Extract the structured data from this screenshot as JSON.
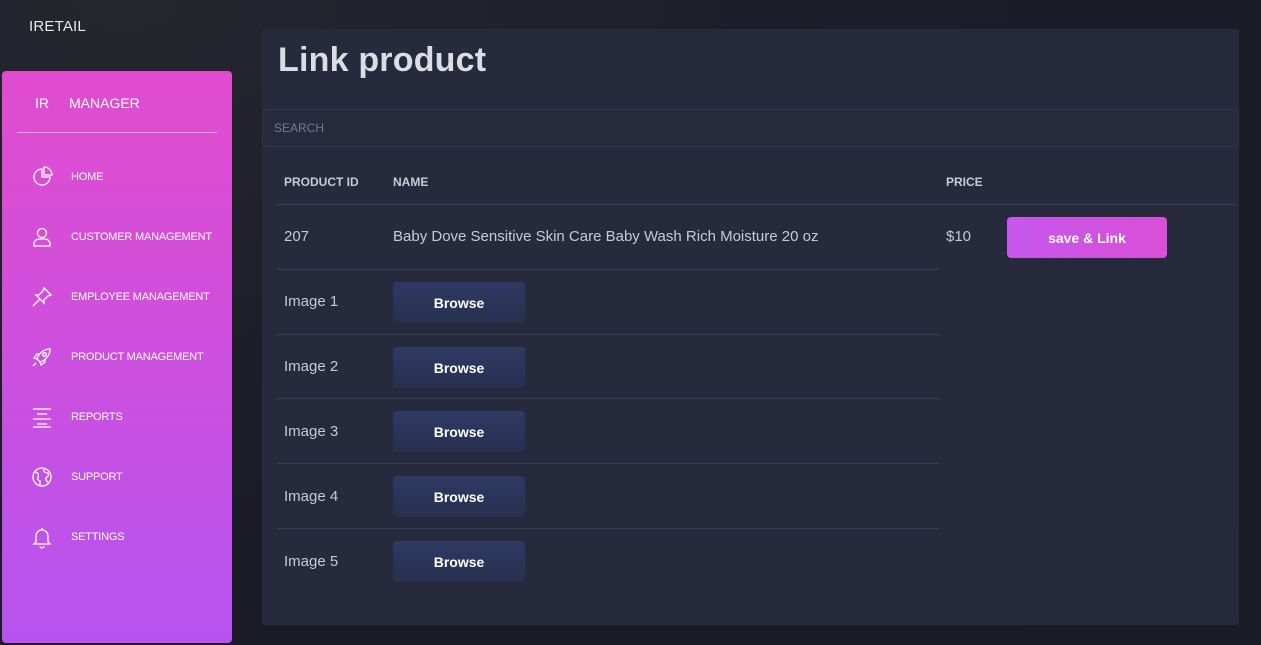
{
  "brand": "IRETAIL",
  "sidebar": {
    "logo_mini": "IR",
    "logo_full": "MANAGER",
    "items": [
      {
        "label": "HOME",
        "icon": "pie-chart-icon"
      },
      {
        "label": "CUSTOMER MANAGEMENT",
        "icon": "user-icon"
      },
      {
        "label": "EMPLOYEE MANAGEMENT",
        "icon": "pin-icon"
      },
      {
        "label": "PRODUCT MANAGEMENT",
        "icon": "rocket-icon"
      },
      {
        "label": "REPORTS",
        "icon": "align-center-icon"
      },
      {
        "label": "SUPPORT",
        "icon": "globe-icon"
      },
      {
        "label": "SETTINGS",
        "icon": "bell-icon"
      }
    ]
  },
  "main": {
    "title": "Link product",
    "search_placeholder": "SEARCH",
    "table": {
      "headers": {
        "product_id": "PRODUCT ID",
        "name": "NAME",
        "price": "PRICE"
      },
      "product": {
        "id": "207",
        "name": "Baby Dove Sensitive Skin Care Baby Wash Rich Moisture 20 oz",
        "price": "$10"
      },
      "save_label": "save & Link",
      "images": [
        {
          "label": "Image 1",
          "button": "Browse"
        },
        {
          "label": "Image 2",
          "button": "Browse"
        },
        {
          "label": "Image 3",
          "button": "Browse"
        },
        {
          "label": "Image 4",
          "button": "Browse"
        },
        {
          "label": "Image 5",
          "button": "Browse"
        }
      ]
    }
  },
  "colors": {
    "sidebar_gradient_top": "#e14ccf",
    "sidebar_gradient_bottom": "#b653f0",
    "card_bg": "#262a3c",
    "browse_button": "#2f3a63",
    "save_button": "#c656ec"
  }
}
